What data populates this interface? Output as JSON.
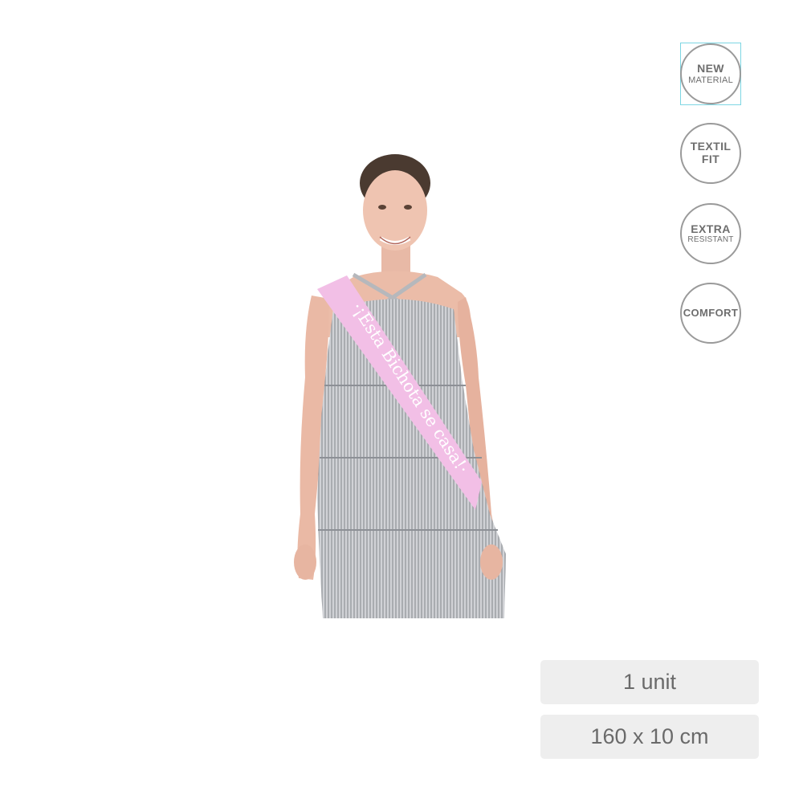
{
  "badges": [
    {
      "line1": "NEW",
      "line2": "MATERIAL"
    },
    {
      "line1": "TEXTIL",
      "line2": "FIT"
    },
    {
      "line1": "EXTRA",
      "line2": "RESISTANT"
    },
    {
      "line1": "COMFORT"
    }
  ],
  "product": {
    "sash_text": "·¡Esta Bichota se casa!·",
    "sash_color": "#f2bfe6",
    "dress_color": "#b9bbbf"
  },
  "info": {
    "units": "1 unit",
    "size": "160 x 10 cm"
  }
}
